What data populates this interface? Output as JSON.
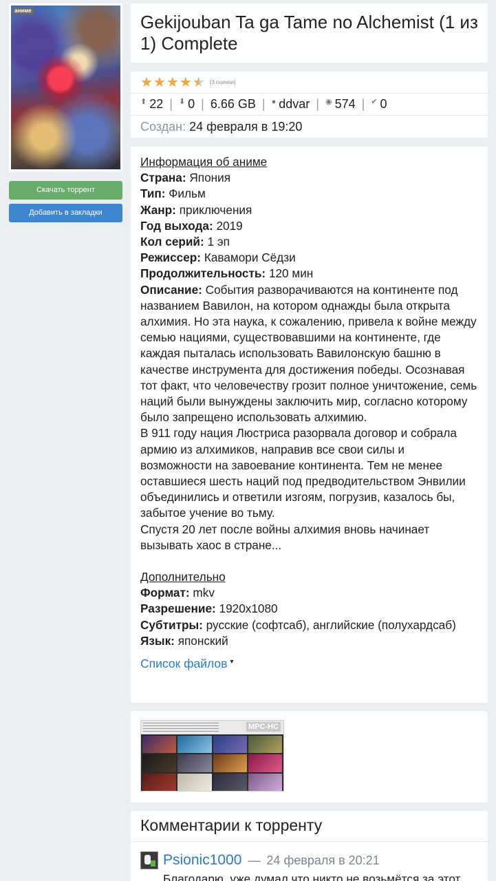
{
  "poster": {
    "badge": "аниме"
  },
  "buttons": {
    "download": "Скачать торрент",
    "bookmark": "Добавить в закладки"
  },
  "title": "Gekijouban Ta ga Tame no Alchemist (1 из 1) Complete",
  "rating": {
    "stars_filled": 4,
    "stars_total": 5,
    "count_text": "(3 оценки)",
    "colors": {
      "filled": "#f2a93b",
      "empty": "#c9ccd0"
    }
  },
  "stats": {
    "seeders": "22",
    "leechers": "0",
    "size": "6.66 GB",
    "uploader": "ddvar",
    "views": "574",
    "completed": "0",
    "icons": [
      "upload-arrow-icon",
      "download-arrow-icon",
      "user-icon",
      "eye-icon",
      "check-badge-icon"
    ]
  },
  "created": {
    "label": "Создан:",
    "date": "24 февраля в 19:20"
  },
  "info": {
    "heading": "Информация об аниме",
    "country_label": "Страна:",
    "country": "Япония",
    "type_label": "Тип:",
    "type": "Фильм",
    "genre_label": "Жанр:",
    "genre": "приключения",
    "year_label": "Год выхода:",
    "year": "2019",
    "episodes_label": "Кол серий:",
    "episodes": "1 эп",
    "director_label": "Режиссер:",
    "director": "Кавамори Сёдзи",
    "duration_label": "Продолжительность:",
    "duration": "120 мин",
    "description_label": "Описание:",
    "description_p1": "События разворачиваются на континенте под названием Вавилон, на котором однажды была открыта алхимия. Но эта наука, к сожалению, привела к войне между семью нациями, существовавшими на континенте, где каждая пыталась использовать Вавилонскую башню в качестве инструмента для достижения победы. Осознавая тот факт, что человечеству грозит полное уничтожение, семь наций были вынуждены заключить мир, согласно которому было запрещено использовать алхимию.",
    "description_p2": "В 911 году нация Люстриса разорвала договор и собрала армию из алхимиков, направив все свои силы и возможности на завоевание континента. Тем не менее оставшиеся шесть наций под предводительством Энвилии объединились и ответили изгоям, погрузив, казалось бы, забытое учение во тьму.",
    "description_p3": "Спустя 20 лет после войны алхимия вновь начинает вызывать хаос в стране..."
  },
  "extra": {
    "heading": "Дополнительно",
    "format_label": "Формат:",
    "format": "mkv",
    "resolution_label": "Разрешение:",
    "resolution": "1920x1080",
    "subs_label": "Субтитры:",
    "subs": "русские (софтсаб), английские (полухардсаб)",
    "lang_label": "Язык:",
    "lang": "японский"
  },
  "file_list_link": "Список файлов",
  "screenshot": {
    "logo": "MPC-HC"
  },
  "comments": {
    "title": "Комментарии к торренту",
    "items": [
      {
        "user": "Psionic1000",
        "date": "24 февраля в 20:21",
        "text": "Благодарю, уже думал что никто не возьмётся за этот"
      }
    ]
  }
}
